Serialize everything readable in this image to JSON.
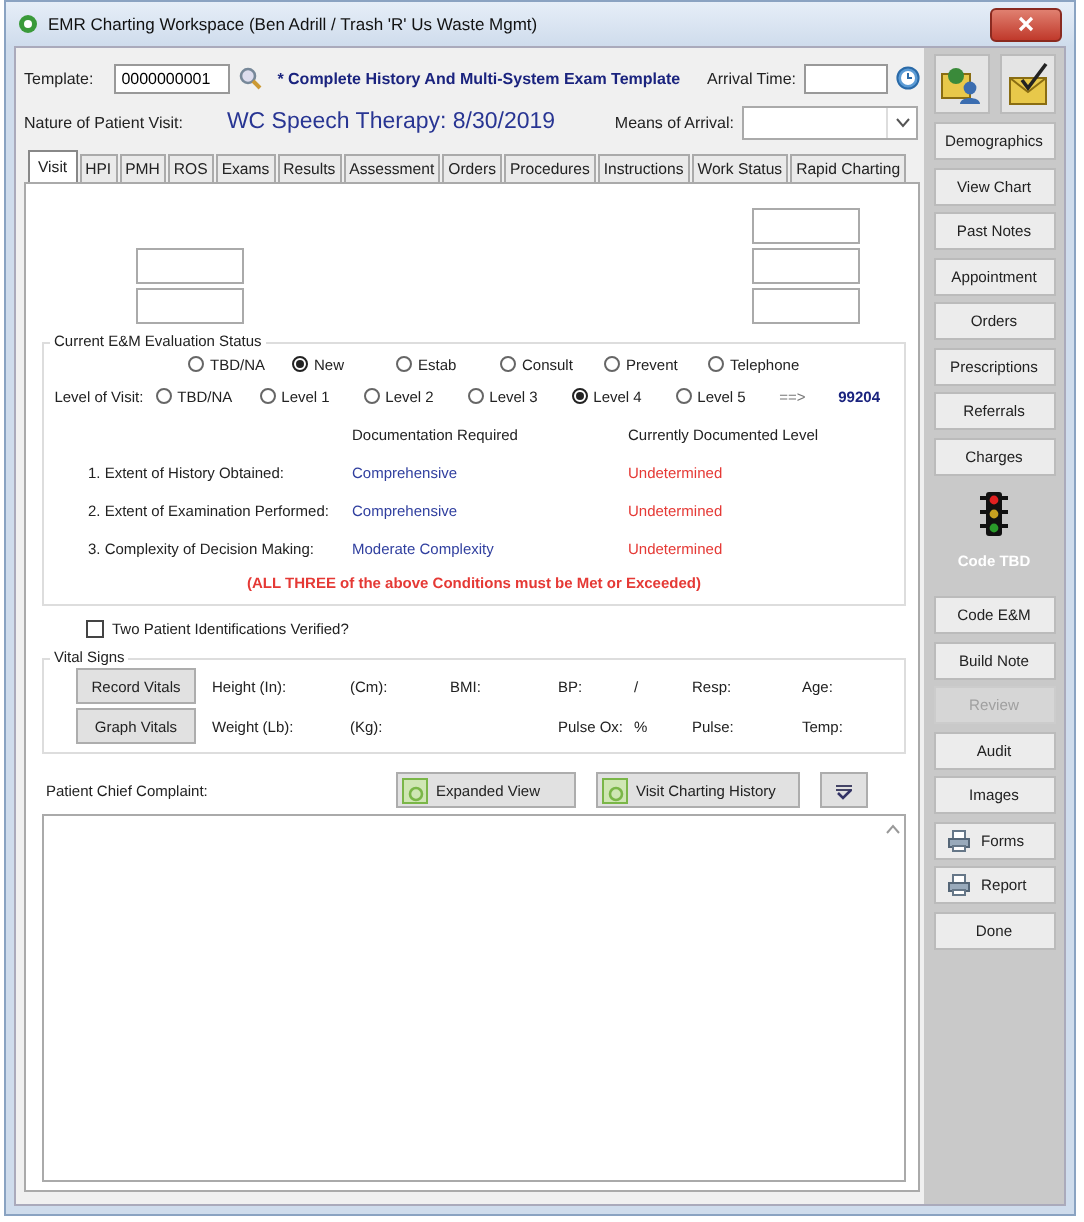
{
  "window": {
    "title": "EMR Charting Workspace (Ben Adrill / Trash 'R' Us Waste Mgmt)"
  },
  "template": {
    "label": "Template:",
    "value": "0000000001",
    "name": "* Complete History And Multi-System Exam Template"
  },
  "arrival_time": {
    "label": "Arrival Time:"
  },
  "nature": {
    "label": "Nature of Patient Visit:",
    "value": "WC Speech Therapy:  8/30/2019"
  },
  "means_of_arrival": {
    "label": "Means of Arrival:"
  },
  "tabs": [
    {
      "label": "Visit",
      "selected": true
    },
    {
      "label": "HPI",
      "selected": false
    },
    {
      "label": "PMH",
      "selected": false
    },
    {
      "label": "ROS",
      "selected": false
    },
    {
      "label": "Exams",
      "selected": false
    },
    {
      "label": "Results",
      "selected": false
    },
    {
      "label": "Assessment",
      "selected": false
    },
    {
      "label": "Orders",
      "selected": false
    },
    {
      "label": "Procedures",
      "selected": false
    },
    {
      "label": "Instructions",
      "selected": false
    },
    {
      "label": "Work Status",
      "selected": false
    },
    {
      "label": "Rapid Charting",
      "selected": false
    }
  ],
  "evaluation": {
    "title": "Current E&M Evaluation Status",
    "visit_types": [
      {
        "label": "TBD/NA",
        "selected": false
      },
      {
        "label": "New",
        "selected": true
      },
      {
        "label": "Estab",
        "selected": false
      },
      {
        "label": "Consult",
        "selected": false
      },
      {
        "label": "Prevent",
        "selected": false
      },
      {
        "label": "Telephone",
        "selected": false
      }
    ],
    "level_label": "Level of Visit:",
    "levels": [
      {
        "label": "TBD/NA",
        "selected": false
      },
      {
        "label": "Level 1",
        "selected": false
      },
      {
        "label": "Level 2",
        "selected": false
      },
      {
        "label": "Level 3",
        "selected": false
      },
      {
        "label": "Level 4",
        "selected": true
      },
      {
        "label": "Level 5",
        "selected": false
      }
    ],
    "arrow": "==>",
    "code": "99204",
    "columns": [
      "Documentation Required",
      "Currently Documented Level"
    ],
    "criteria": [
      {
        "label": "1.  Extent of History Obtained:",
        "required": "Comprehensive",
        "documented": "Undetermined"
      },
      {
        "label": "2.  Extent of Examination Performed:",
        "required": "Comprehensive",
        "documented": "Undetermined"
      },
      {
        "label": "3.  Complexity of Decision Making:",
        "required": "Moderate Complexity",
        "documented": "Undetermined"
      }
    ],
    "note": "(ALL THREE of the above Conditions must be Met or Exceeded)"
  },
  "verification": {
    "label": "Two Patient Identifications Verified?",
    "checked": false
  },
  "vitals": {
    "title": "Vital Signs",
    "buttons": [
      "Record Vitals",
      "Graph Vitals"
    ],
    "rows": [
      [
        "Height  (In):",
        "(Cm):",
        "BMI:",
        "BP:",
        "/",
        "Resp:",
        "Age:"
      ],
      [
        "Weight  (Lb):",
        "(Kg):",
        null,
        "Pulse Ox:",
        "%",
        "Pulse:",
        "Temp:"
      ]
    ]
  },
  "complaint": {
    "label": "Patient Chief Complaint:",
    "buttons": [
      "Expanded View",
      "Visit Charting History"
    ]
  },
  "sidebar": {
    "buttons": [
      {
        "label": "Demographics",
        "disabled": false
      },
      {
        "label": "View Chart",
        "disabled": false
      },
      {
        "label": "Past Notes",
        "disabled": false
      },
      {
        "label": "Appointment",
        "disabled": false
      },
      {
        "label": "Orders",
        "disabled": false
      },
      {
        "label": "Prescriptions",
        "disabled": false
      },
      {
        "label": "Referrals",
        "disabled": false
      },
      {
        "label": "Charges",
        "disabled": false
      }
    ],
    "code_status": "Code TBD",
    "buttons_lower": [
      {
        "label": "Code E&M",
        "disabled": false,
        "kind": "text"
      },
      {
        "label": "Build Note",
        "disabled": false,
        "kind": "text"
      },
      {
        "label": "Review",
        "disabled": true,
        "kind": "text"
      },
      {
        "label": "Audit",
        "disabled": false,
        "kind": "text"
      },
      {
        "label": "Images",
        "disabled": false,
        "kind": "text"
      },
      {
        "label": "Forms",
        "disabled": false,
        "kind": "printer"
      },
      {
        "label": "Report",
        "disabled": false,
        "kind": "printer"
      },
      {
        "label": "Done",
        "disabled": false,
        "kind": "text"
      }
    ]
  }
}
